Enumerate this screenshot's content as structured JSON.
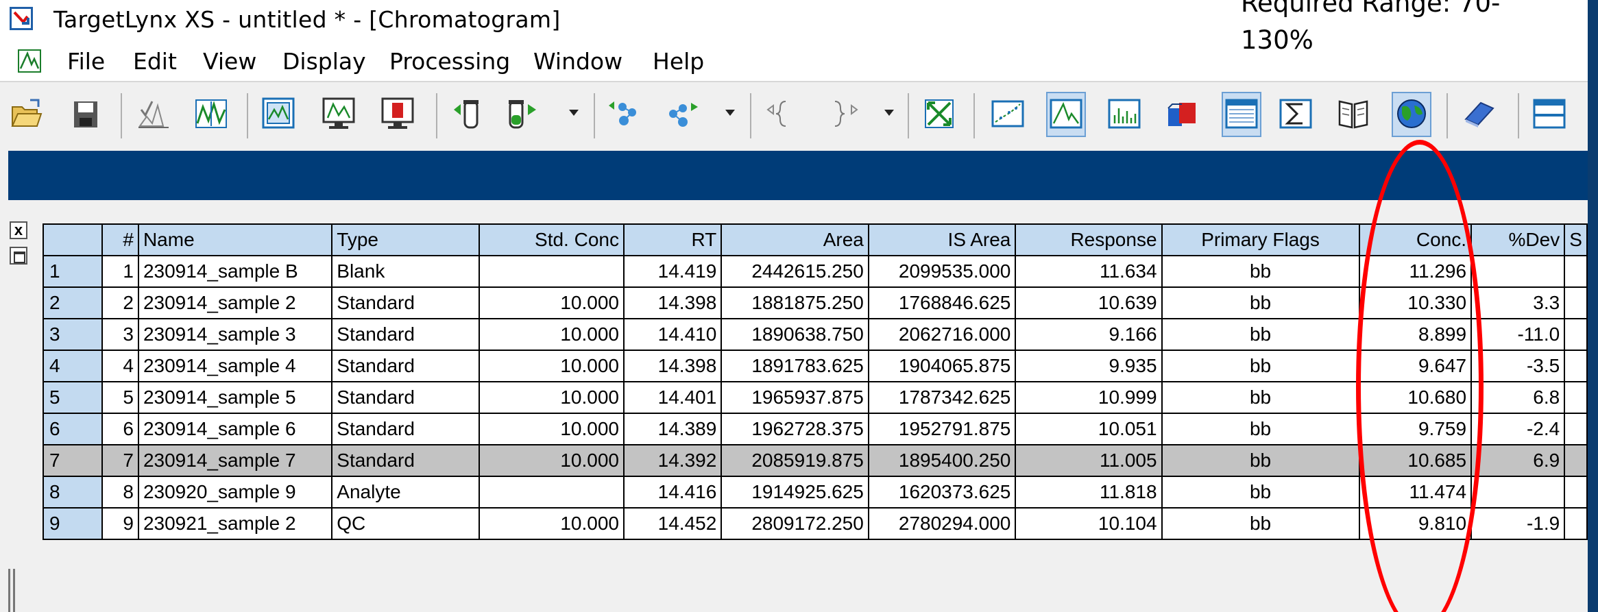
{
  "window": {
    "title": "TargetLynx XS - untitled * - [Chromatogram]"
  },
  "annotation": {
    "text": "Required Range: 70-\n130%"
  },
  "menu": [
    "File",
    "Edit",
    "View",
    "Display",
    "Processing",
    "Window",
    "Help"
  ],
  "side": {
    "close_label": "x"
  },
  "table": {
    "headers": [
      "",
      "#",
      "Name",
      "Type",
      "Std. Conc",
      "RT",
      "Area",
      "IS Area",
      "Response",
      "Primary Flags",
      "Conc.",
      "%Dev",
      "S"
    ],
    "rows": [
      [
        "1",
        "1",
        "230914_sample B",
        "Blank",
        "",
        "14.419",
        "2442615.250",
        "2099535.000",
        "11.634",
        "bb",
        "11.296",
        "",
        ""
      ],
      [
        "2",
        "2",
        "230914_sample 2",
        "Standard",
        "10.000",
        "14.398",
        "1881875.250",
        "1768846.625",
        "10.639",
        "bb",
        "10.330",
        "3.3",
        ""
      ],
      [
        "3",
        "3",
        "230914_sample 3",
        "Standard",
        "10.000",
        "14.410",
        "1890638.750",
        "2062716.000",
        "9.166",
        "bb",
        "8.899",
        "-11.0",
        ""
      ],
      [
        "4",
        "4",
        "230914_sample 4",
        "Standard",
        "10.000",
        "14.398",
        "1891783.625",
        "1904065.875",
        "9.935",
        "bb",
        "9.647",
        "-3.5",
        ""
      ],
      [
        "5",
        "5",
        "230914_sample 5",
        "Standard",
        "10.000",
        "14.401",
        "1965937.875",
        "1787342.625",
        "10.999",
        "bb",
        "10.680",
        "6.8",
        ""
      ],
      [
        "6",
        "6",
        "230914_sample 6",
        "Standard",
        "10.000",
        "14.389",
        "1962728.375",
        "1952791.875",
        "10.051",
        "bb",
        "9.759",
        "-2.4",
        ""
      ],
      [
        "7",
        "7",
        "230914_sample 7",
        "Standard",
        "10.000",
        "14.392",
        "2085919.875",
        "1895400.250",
        "11.005",
        "bb",
        "10.685",
        "6.9",
        ""
      ],
      [
        "8",
        "8",
        "230920_sample 9",
        "Analyte",
        "",
        "14.416",
        "1914925.625",
        "1620373.625",
        "11.818",
        "bb",
        "11.474",
        "",
        ""
      ],
      [
        "9",
        "9",
        "230921_sample 2",
        "QC",
        "10.000",
        "14.452",
        "2809172.250",
        "2780294.000",
        "10.104",
        "bb",
        "9.810",
        "-1.9",
        ""
      ]
    ],
    "selected_row": 7
  },
  "colors": {
    "banner": "#003c78",
    "header_bg": "#c3daf0",
    "selected_row": "#c3c3c3",
    "highlight_ellipse": "#ff0000"
  },
  "toolbar_icons": [
    "open-folder-icon",
    "save-disk-icon",
    "peak-integrate-icon",
    "smooth-icon",
    "chromatogram-icon",
    "display-spectrum-icon",
    "display-red-icon",
    "vial-prev-icon",
    "vial-next-icon",
    "molecule-left-icon",
    "molecule-right-icon",
    "bracket-prev-icon",
    "bracket-next-icon",
    "fit-zoom-icon",
    "calibration-curve-icon",
    "chromatogram-view-icon",
    "spectrum-bars-icon",
    "3d-shapes-icon",
    "summary-table-icon",
    "sum-icon",
    "book-icon",
    "globe-icon",
    "disk-report-icon",
    "split-window-icon"
  ]
}
